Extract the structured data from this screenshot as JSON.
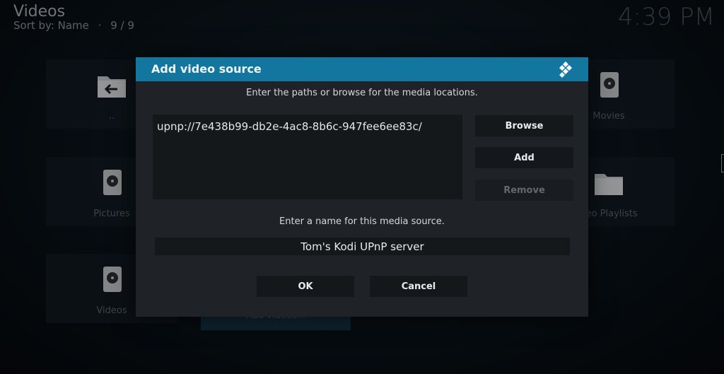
{
  "header": {
    "title": "Videos",
    "sort_label": "Sort by: Name",
    "sort_separator": "·",
    "count": "9 / 9",
    "clock": "4:39 PM"
  },
  "tiles": [
    {
      "label": "..",
      "icon": "folder-back-icon"
    },
    {
      "label": "Movies",
      "icon": "hard-drive-icon"
    },
    {
      "label": "Pictures",
      "icon": "hard-drive-icon"
    },
    {
      "label": "deo Playlists",
      "icon": "folder-icon"
    },
    {
      "label": "Videos",
      "icon": "hard-drive-icon"
    }
  ],
  "background_button": {
    "label": "Add videos..."
  },
  "dialog": {
    "title": "Add video source",
    "logo_icon": "kodi-logo-icon",
    "paths_prompt": "Enter the paths or browse for the media locations.",
    "paths": [
      "upnp://7e438b99-db2e-4ac8-8b6c-947fee6ee83c/"
    ],
    "browse_label": "Browse",
    "add_label": "Add",
    "remove_label": "Remove",
    "name_prompt": "Enter a name for this media source.",
    "name_value": "Tom's Kodi UPnP server",
    "ok_label": "OK",
    "cancel_label": "Cancel",
    "accent_color": "#12769e"
  }
}
